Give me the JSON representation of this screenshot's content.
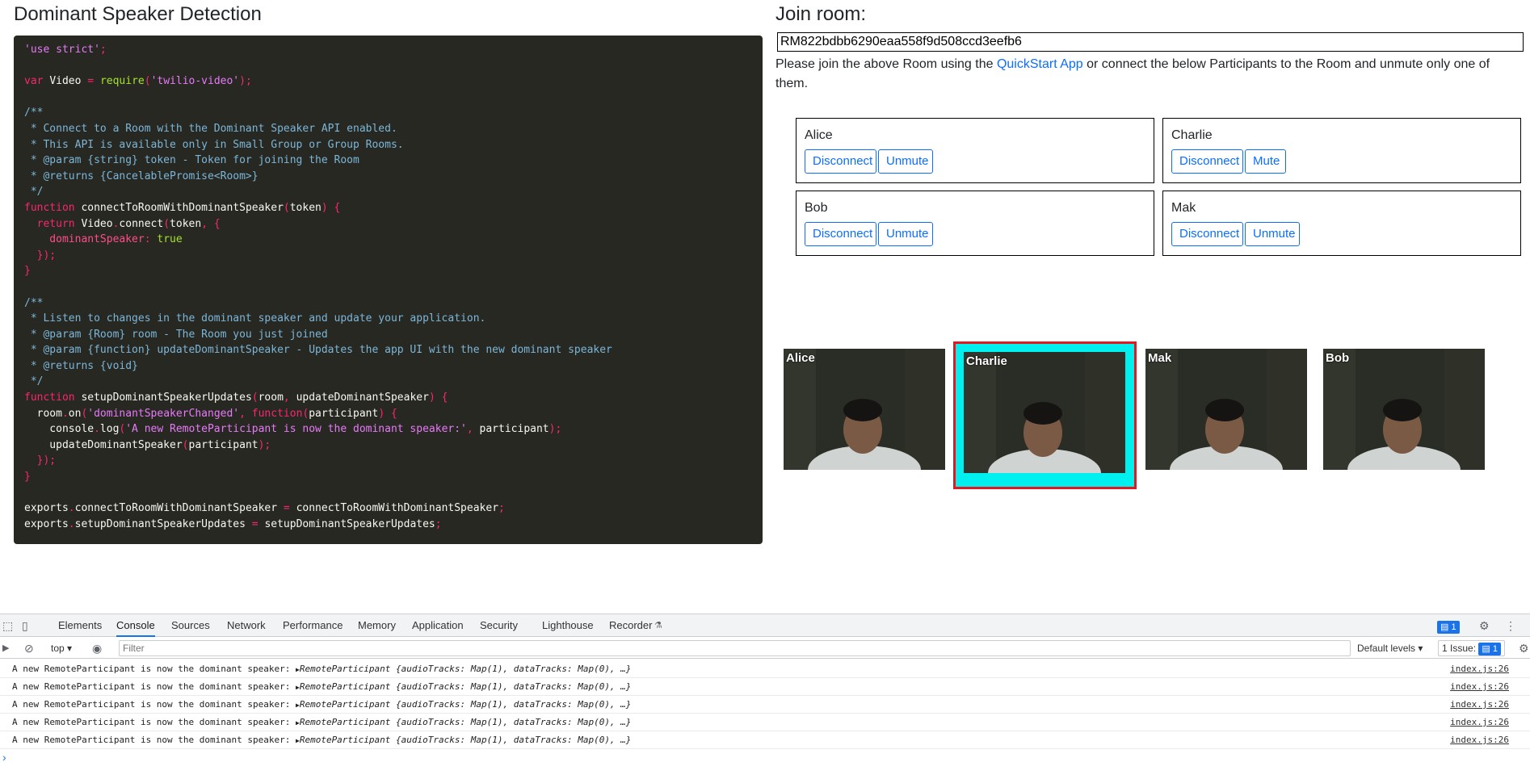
{
  "left": {
    "title": "Dominant Speaker Detection",
    "code_lines": [
      [
        [
          "str-m",
          "'use strict'"
        ],
        [
          "pun",
          ";"
        ]
      ],
      [],
      [
        [
          "kw",
          "var "
        ],
        [
          "pl",
          "Video "
        ],
        [
          "pun",
          "= "
        ],
        [
          "fn",
          "require"
        ],
        [
          "pun",
          "("
        ],
        [
          "str-m",
          "'twilio-video'"
        ],
        [
          "pun",
          ");"
        ]
      ],
      [],
      [
        [
          "cm",
          "/**"
        ]
      ],
      [
        [
          "cm",
          " * Connect to a Room with the Dominant Speaker API enabled."
        ]
      ],
      [
        [
          "cm",
          " * This API is available only in Small Group or Group Rooms."
        ]
      ],
      [
        [
          "cm",
          " * @param {string} token - Token for joining the Room"
        ]
      ],
      [
        [
          "cm",
          " * @returns {CancelablePromise<Room>}"
        ]
      ],
      [
        [
          "cm",
          " */"
        ]
      ],
      [
        [
          "kw",
          "function "
        ],
        [
          "pl",
          "connectToRoomWithDominantSpeaker"
        ],
        [
          "pun",
          "("
        ],
        [
          "pl",
          "token"
        ],
        [
          "pun",
          ") {"
        ]
      ],
      [
        [
          "kw",
          "  return "
        ],
        [
          "pl",
          "Video"
        ],
        [
          "pun",
          "."
        ],
        [
          "pl",
          "connect"
        ],
        [
          "pun",
          "("
        ],
        [
          "pl",
          "token"
        ],
        [
          "pun",
          ", {"
        ]
      ],
      [
        [
          "key",
          "    dominantSpeaker"
        ],
        [
          "pun",
          ": "
        ],
        [
          "fn",
          "true"
        ]
      ],
      [
        [
          "pun",
          "  });"
        ]
      ],
      [
        [
          "pun",
          "}"
        ]
      ],
      [],
      [
        [
          "cm",
          "/**"
        ]
      ],
      [
        [
          "cm",
          " * Listen to changes in the dominant speaker and update your application."
        ]
      ],
      [
        [
          "cm",
          " * @param {Room} room - The Room you just joined"
        ]
      ],
      [
        [
          "cm",
          " * @param {function} updateDominantSpeaker - Updates the app UI with the new dominant speaker"
        ]
      ],
      [
        [
          "cm",
          " * @returns {void}"
        ]
      ],
      [
        [
          "cm",
          " */"
        ]
      ],
      [
        [
          "kw",
          "function "
        ],
        [
          "pl",
          "setupDominantSpeakerUpdates"
        ],
        [
          "pun",
          "("
        ],
        [
          "pl",
          "room"
        ],
        [
          "pun",
          ", "
        ],
        [
          "pl",
          "updateDominantSpeaker"
        ],
        [
          "pun",
          ") {"
        ]
      ],
      [
        [
          "pl",
          "  room"
        ],
        [
          "pun",
          "."
        ],
        [
          "pl",
          "on"
        ],
        [
          "pun",
          "("
        ],
        [
          "str-m",
          "'dominantSpeakerChanged'"
        ],
        [
          "pun",
          ", "
        ],
        [
          "kw",
          "function"
        ],
        [
          "pun",
          "("
        ],
        [
          "pl",
          "participant"
        ],
        [
          "pun",
          ") {"
        ]
      ],
      [
        [
          "pl",
          "    console"
        ],
        [
          "pun",
          "."
        ],
        [
          "pl",
          "log"
        ],
        [
          "pun",
          "("
        ],
        [
          "str-m",
          "'A new RemoteParticipant is now the dominant speaker:'"
        ],
        [
          "pun",
          ", "
        ],
        [
          "pl",
          "participant"
        ],
        [
          "pun",
          ");"
        ]
      ],
      [
        [
          "pl",
          "    updateDominantSpeaker"
        ],
        [
          "pun",
          "("
        ],
        [
          "pl",
          "participant"
        ],
        [
          "pun",
          ");"
        ]
      ],
      [
        [
          "pun",
          "  });"
        ]
      ],
      [
        [
          "pun",
          "}"
        ]
      ],
      [],
      [
        [
          "pl",
          "exports"
        ],
        [
          "pun",
          "."
        ],
        [
          "pl",
          "connectToRoomWithDominantSpeaker "
        ],
        [
          "pun",
          "= "
        ],
        [
          "pl",
          "connectToRoomWithDominantSpeaker"
        ],
        [
          "pun",
          ";"
        ]
      ],
      [
        [
          "pl",
          "exports"
        ],
        [
          "pun",
          "."
        ],
        [
          "pl",
          "setupDominantSpeakerUpdates "
        ],
        [
          "pun",
          "= "
        ],
        [
          "pl",
          "setupDominantSpeakerUpdates"
        ],
        [
          "pun",
          ";"
        ]
      ]
    ]
  },
  "right": {
    "title": "Join room:",
    "room_sid": "RM822bdbb6290eaa558f9d508ccd3eefb6",
    "instructions_before": "Please join the above Room using the ",
    "instructions_link": "QuickStart App",
    "instructions_after": " or connect the below Participants to the Room and unmute only one of them.",
    "participants": [
      {
        "name": "Alice",
        "disconnect_label": "Disconnect",
        "toggle_label": "Unmute"
      },
      {
        "name": "Charlie",
        "disconnect_label": "Disconnect",
        "toggle_label": "Mute"
      },
      {
        "name": "Bob",
        "disconnect_label": "Disconnect",
        "toggle_label": "Unmute"
      },
      {
        "name": "Mak",
        "disconnect_label": "Disconnect",
        "toggle_label": "Unmute"
      }
    ],
    "tiles": [
      {
        "name": "Alice",
        "dominant": false
      },
      {
        "name": "Charlie",
        "dominant": true
      },
      {
        "name": "Mak",
        "dominant": false
      },
      {
        "name": "Bob",
        "dominant": false
      }
    ],
    "colors": {
      "dominant_border": "#e5181f",
      "dominant_fill": "#00f0f0",
      "link": "#0d6efd"
    }
  },
  "devtools": {
    "tabs": [
      "Elements",
      "Console",
      "Sources",
      "Network",
      "Performance",
      "Memory",
      "Application",
      "Security",
      "Lighthouse",
      "Recorder"
    ],
    "active_tab": "Console",
    "context": "top",
    "filter_placeholder": "Filter",
    "levels": "Default levels",
    "issues_label": "1 Issue:",
    "issues_count": "1",
    "messages_count": "1",
    "logs": [
      {
        "text": "A new RemoteParticipant is now the dominant speaker: ",
        "object": "RemoteParticipant {audioTracks: Map(1), dataTracks: Map(0), …}",
        "source": "index.js:26"
      },
      {
        "text": "A new RemoteParticipant is now the dominant speaker: ",
        "object": "RemoteParticipant {audioTracks: Map(1), dataTracks: Map(0), …}",
        "source": "index.js:26"
      },
      {
        "text": "A new RemoteParticipant is now the dominant speaker: ",
        "object": "RemoteParticipant {audioTracks: Map(1), dataTracks: Map(0), …}",
        "source": "index.js:26"
      },
      {
        "text": "A new RemoteParticipant is now the dominant speaker: ",
        "object": "RemoteParticipant {audioTracks: Map(1), dataTracks: Map(0), …}",
        "source": "index.js:26"
      },
      {
        "text": "A new RemoteParticipant is now the dominant speaker: ",
        "object": "RemoteParticipant {audioTracks: Map(1), dataTracks: Map(0), …}",
        "source": "index.js:26"
      }
    ],
    "prompt": "›"
  }
}
